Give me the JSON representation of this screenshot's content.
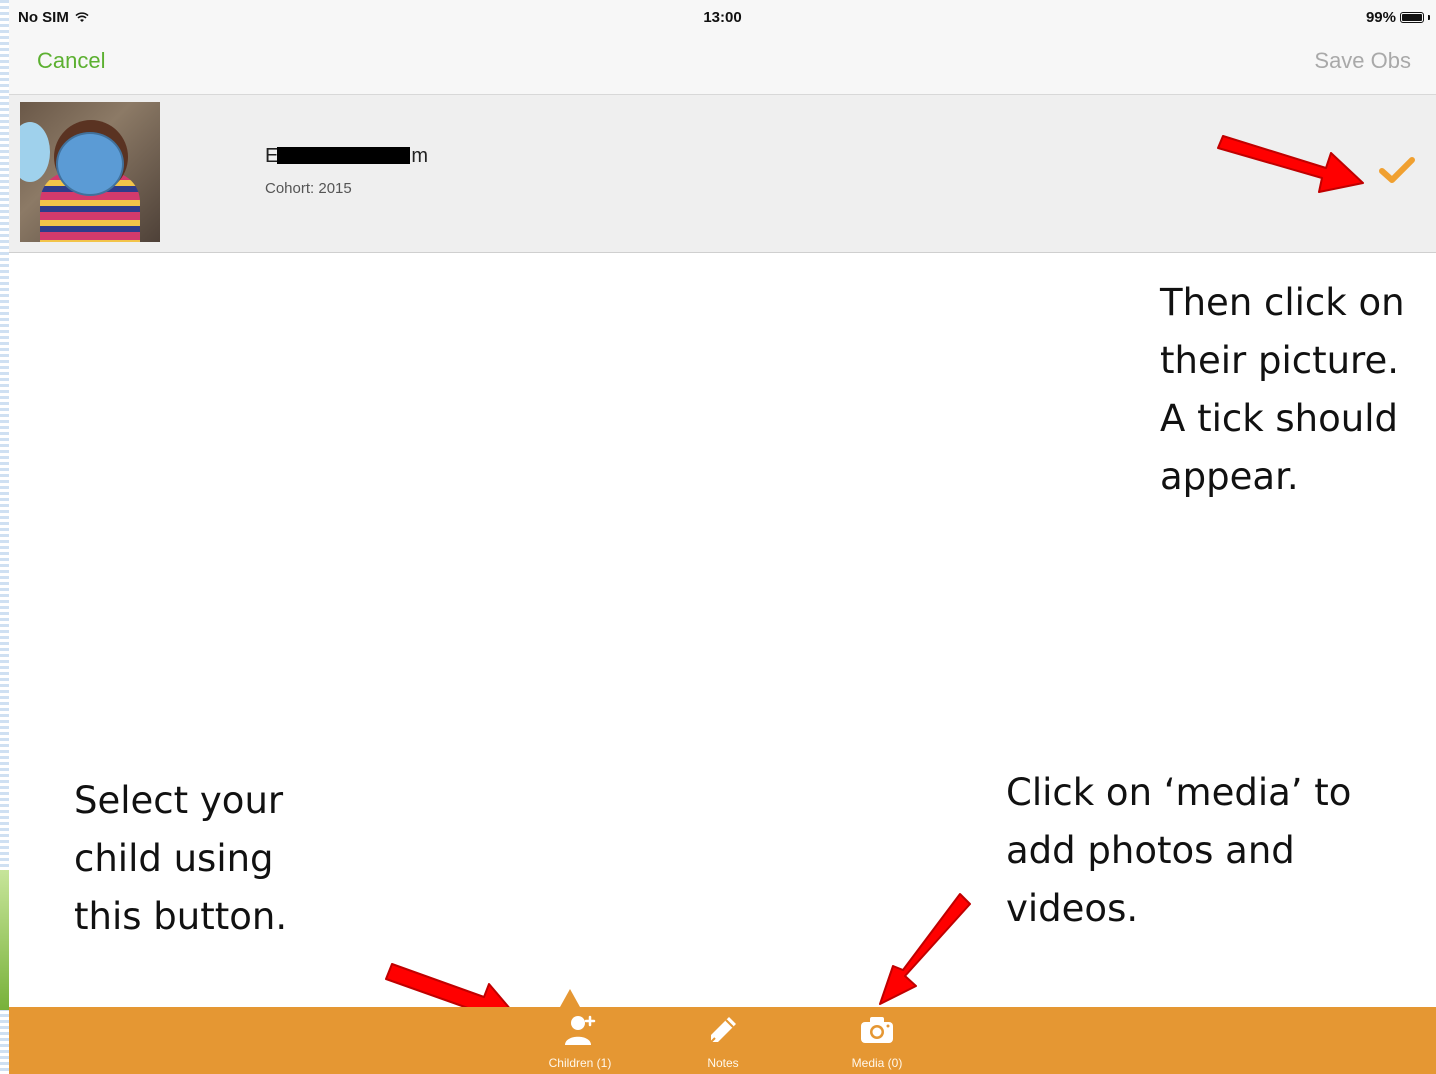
{
  "status_bar": {
    "carrier": "No SIM",
    "time": "13:00",
    "battery": "99%"
  },
  "nav": {
    "cancel_label": "Cancel",
    "save_label": "Save Obs"
  },
  "child": {
    "name_start": "E",
    "name_end": "m",
    "cohort": "Cohort: 2015",
    "selected": true
  },
  "annotations": {
    "tick_hint": "Then click on their picture. A tick should appear.",
    "select_hint": "Select your child using this button.",
    "media_hint": "Click on ‘media’ to add photos and videos."
  },
  "tabs": [
    {
      "label": "Children (1)",
      "icon": "add-child-icon",
      "active": true
    },
    {
      "label": "Notes",
      "icon": "pencil-icon",
      "active": false
    },
    {
      "label": "Media (0)",
      "icon": "camera-icon",
      "active": false
    }
  ],
  "colors": {
    "accent_green": "#5cb031",
    "tab_bar_orange": "#e59733",
    "tick_orange": "#f0a030",
    "arrow_red": "#ff0000",
    "disabled_gray": "#a9a9a9"
  }
}
